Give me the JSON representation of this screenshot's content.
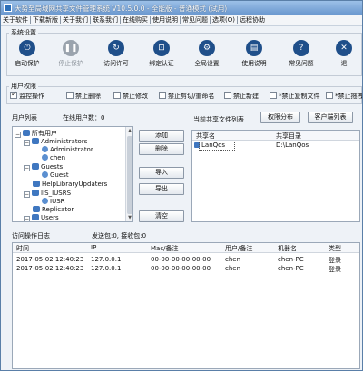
{
  "window": {
    "title": "大势至局域网共享文件管理系统 V10.5.0.0 - 全能版 - 普通模式 (试用)"
  },
  "menu": [
    "关于软件",
    "下载新版",
    "关于我们",
    "联系我们",
    "在线购买",
    "使用说明",
    "常见问题",
    "选项(O)",
    "远程协助"
  ],
  "system_settings": {
    "title": "系统设置",
    "tools": [
      {
        "label": "启动保护",
        "icon": "power-icon",
        "disabled": false
      },
      {
        "label": "停止保护",
        "icon": "pause-icon",
        "disabled": true
      },
      {
        "label": "访问许可",
        "icon": "refresh-icon",
        "disabled": false
      },
      {
        "label": "绑定认证",
        "icon": "lock-icon",
        "disabled": false
      },
      {
        "label": "全局设置",
        "icon": "gear-icon",
        "disabled": false
      },
      {
        "label": "使用说明",
        "icon": "book-icon",
        "disabled": false
      },
      {
        "label": "常见问题",
        "icon": "question-icon",
        "disabled": false
      },
      {
        "label": "退",
        "icon": "exit-icon",
        "disabled": false
      }
    ]
  },
  "permissions": {
    "title": "用户权限",
    "items": [
      {
        "label": "监控操作",
        "checked": true
      },
      {
        "label": "禁止删除",
        "checked": false
      },
      {
        "label": "禁止修改",
        "checked": false
      },
      {
        "label": "禁止剪切/重命名",
        "checked": false
      },
      {
        "label": "禁止新建",
        "checked": false
      },
      {
        "label": "*禁止复制文件",
        "checked": false
      },
      {
        "label": "*禁止拖拽文",
        "checked": false
      }
    ]
  },
  "users": {
    "label": "用户列表",
    "online_label": "在线用户数：0",
    "tree": [
      {
        "text": "所有用户",
        "level": 0,
        "type": "group",
        "expander": "-"
      },
      {
        "text": "Administrators",
        "level": 1,
        "type": "group",
        "expander": "-"
      },
      {
        "text": "Administrator",
        "level": 2,
        "type": "user",
        "expander": ""
      },
      {
        "text": "chen",
        "level": 2,
        "type": "user",
        "expander": ""
      },
      {
        "text": "Guests",
        "level": 1,
        "type": "group",
        "expander": "-"
      },
      {
        "text": "Guest",
        "level": 2,
        "type": "user",
        "expander": ""
      },
      {
        "text": "HelpLibraryUpdaters",
        "level": 1,
        "type": "group",
        "expander": ""
      },
      {
        "text": "IIS_IUSRS",
        "level": 1,
        "type": "group",
        "expander": "-"
      },
      {
        "text": "IUSR",
        "level": 2,
        "type": "user",
        "expander": ""
      },
      {
        "text": "Replicator",
        "level": 1,
        "type": "group",
        "expander": ""
      },
      {
        "text": "Users",
        "level": 1,
        "type": "group",
        "expander": "-"
      }
    ]
  },
  "actions": {
    "add": "添加",
    "remove": "删除",
    "import": "导入",
    "export": "导出",
    "clear": "清空"
  },
  "shares": {
    "label": "当前共享文件列表",
    "perm_button": "权限分布",
    "client_button": "客户端列表",
    "columns": [
      "共享名",
      "共享目录"
    ],
    "rows": [
      {
        "name": "LanQos",
        "dir": "D:\\LanQos"
      }
    ]
  },
  "log": {
    "label": "访问操作日志",
    "stats": "发送包:0, 接收包:0",
    "columns": [
      "时间",
      "IP",
      "Mac/备注",
      "用户/备注",
      "机器名",
      "类型"
    ],
    "rows": [
      [
        "2017-05-02 12:40:23",
        "127.0.0.1",
        "00-00-00-00-00-00",
        "chen",
        "chen-PC",
        "登录"
      ],
      [
        "2017-05-02 12:40:23",
        "127.0.0.1",
        "00-00-00-00-00-00",
        "chen",
        "chen-PC",
        "登录"
      ]
    ]
  }
}
